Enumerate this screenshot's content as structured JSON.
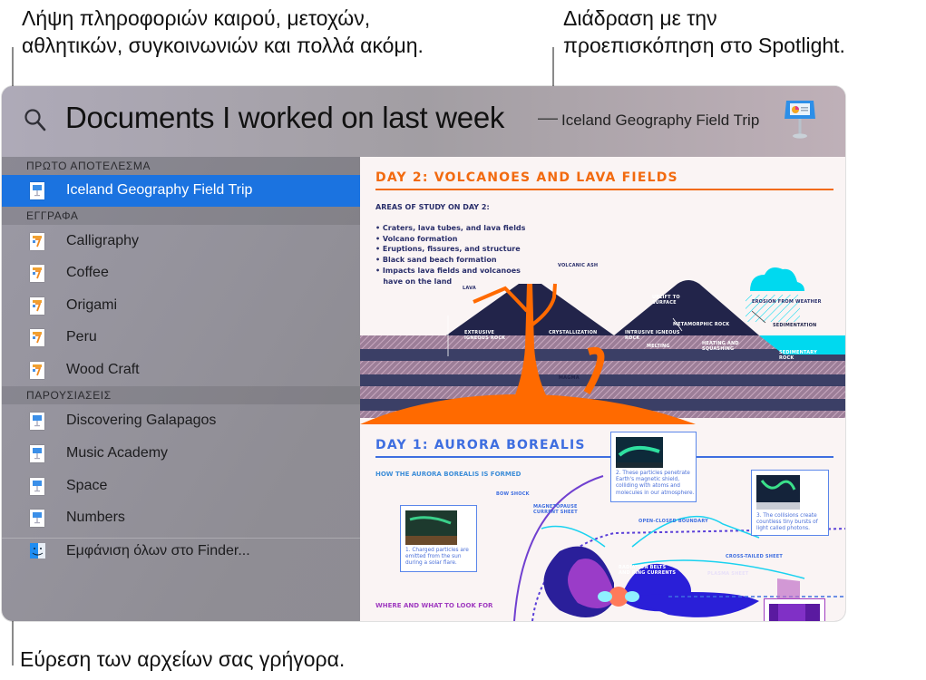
{
  "callouts": {
    "top_left": [
      "Λήψη πληροφοριών καιρού, μετοχών,",
      "αθλητικών, συγκοινωνιών και πολλά ακόμη."
    ],
    "top_right": [
      "Διάδραση με την",
      "προεπισκόπηση στο Spotlight."
    ],
    "bottom_left": "Εύρεση των αρχείων σας γρήγορα."
  },
  "search": {
    "query": "Documents I worked on last week",
    "separator": "—",
    "preview_title": "Iceland Geography Field Trip",
    "icon": "magnifier-icon",
    "app_icon": "keynote-icon"
  },
  "sidebar": {
    "sections": [
      {
        "header": "ΠΡΩΤΟ ΑΠΟΤΕΛΕΣΜΑ",
        "items": [
          {
            "label": "Iceland Geography Field Trip",
            "icon": "keynote-file-icon",
            "selected": true
          }
        ]
      },
      {
        "header": "ΕΓΓΡΑΦΑ",
        "items": [
          {
            "label": "Calligraphy",
            "icon": "pages-file-icon"
          },
          {
            "label": "Coffee",
            "icon": "pages-file-icon"
          },
          {
            "label": "Origami",
            "icon": "pages-file-icon"
          },
          {
            "label": "Peru",
            "icon": "pages-file-icon"
          },
          {
            "label": "Wood Craft",
            "icon": "pages-file-icon"
          }
        ]
      },
      {
        "header": "ΠΑΡΟΥΣΙΑΣΕΙΣ",
        "items": [
          {
            "label": "Discovering Galapagos",
            "icon": "keynote-file-icon"
          },
          {
            "label": "Music Academy",
            "icon": "keynote-file-icon"
          },
          {
            "label": "Space",
            "icon": "keynote-file-icon"
          },
          {
            "label": "Numbers",
            "icon": "keynote-file-icon"
          }
        ]
      }
    ],
    "show_all": {
      "label": "Εμφάνιση όλων στο Finder...",
      "icon": "finder-icon"
    }
  },
  "preview": {
    "day2": {
      "title": "DAY 2: VOLCANOES AND LAVA FIELDS",
      "subtitle": "AREAS OF STUDY ON DAY 2:",
      "bullets": [
        "• Craters, lava tubes, and lava fields",
        "• Volcano formation",
        "• Eruptions, fissures, and structure",
        "• Black sand beach formation",
        "• Impacts lava fields and volcanoes",
        "   have on the land"
      ],
      "labels": {
        "volcanic_ash": "VOLCANIC ASH",
        "lava": "LAVA",
        "uplift": [
          "UPLIFT TO",
          "SURFACE"
        ],
        "erosion": "EROSION FROM WEATHER",
        "sedimentation": "SEDIMENTATION",
        "extrusive": [
          "EXTRUSIVE",
          "IGNEOUS ROCK"
        ],
        "crystallization": "CRYSTALLIZATION",
        "intrusive": [
          "INTRUSIVE IGNEOUS",
          "ROCK"
        ],
        "metamorphic": "METAMORPHIC ROCK",
        "melting": "MELTING",
        "heating": [
          "HEATING AND",
          "SQUASHING"
        ],
        "sedimentary": [
          "SEDIMENTARY",
          "ROCK"
        ],
        "magma": "MAGMA"
      }
    },
    "day1": {
      "title": "DAY 1: AURORA BOREALIS",
      "subtitle": "HOW THE AURORA BOREALIS IS FORMED",
      "footer": "WHERE AND WHAT TO LOOK FOR",
      "labels": {
        "bow_shock": "BOW SHOCK",
        "magnetopause": [
          "MAGNETOPAUSE",
          "CURRENT SHEET"
        ],
        "open_closed": "OPEN-CLOSED BOUNDARY",
        "radiation": [
          "RADIATION BELTS",
          "AND RING CURRENTS"
        ],
        "cross_tailed": "CROSS-TAILED SHEET",
        "plasma": "PLASMA SHEET"
      },
      "cards": [
        {
          "caption": [
            "1. Charged particles are",
            "emitted from the sun",
            "during a solar flare."
          ]
        },
        {
          "caption": [
            "2. These particles penetrate",
            "Earth's magnetic shield,",
            "colliding with atoms and",
            "molecules in our atmosphere."
          ]
        },
        {
          "caption": [
            "3. The collisions create",
            "countless tiny bursts of",
            "light called photons."
          ]
        }
      ]
    }
  },
  "colors": {
    "selection": "#1b73e0",
    "accent_orange": "#f26a0f",
    "navy": "#22244a",
    "aurora_blue": "#3e6ee0",
    "cyan": "#00d9ef",
    "purple": "#a03cc0"
  }
}
